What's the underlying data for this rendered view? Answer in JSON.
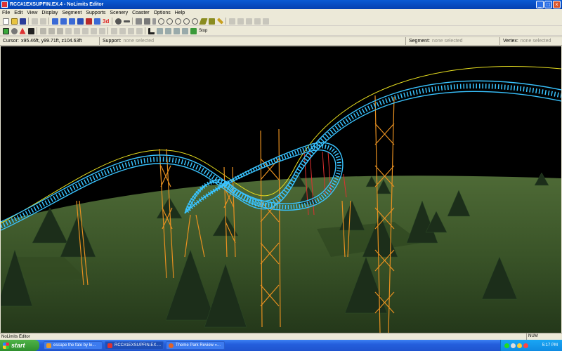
{
  "window": {
    "title": "RCC#1EXSUPFIN.EX.4 - NoLimits Editor"
  },
  "menu": [
    "File",
    "Edit",
    "View",
    "Display",
    "Segment",
    "Supports",
    "Scenery",
    "Coaster",
    "Options",
    "Help"
  ],
  "toolbar1_icons": [
    "new-file-icon",
    "open-file-icon",
    "save-icon",
    "undo-icon",
    "redo-icon",
    "track-up-icon",
    "track-wave-icon",
    "track-down-icon",
    "train-icon",
    "train-station-icon",
    "bolt-icon",
    "3d-view-icon",
    "add-vertex-icon",
    "remove-vertex-icon",
    "pencil-icon",
    "paint-icon",
    "dollar-icon",
    "support-a-icon",
    "support-b-icon",
    "support-c-icon",
    "support-d-icon",
    "support-e-icon",
    "measure-icon",
    "paint-bucket-icon",
    "highlight-icon",
    "tool-a-icon",
    "tool-b-icon",
    "tool-c-icon",
    "tool-d-icon",
    "tool-e-icon"
  ],
  "toolbar1_label_3d": "3d",
  "toolbar2_label_stop": "Stop",
  "infobar": {
    "cursor_label": "Cursor:",
    "cursor_value": "x95.46ft, y99.71ft, z104.63ft",
    "support_label": "Support:",
    "support_value": "none selected",
    "segment_label": "Segment:",
    "segment_value": "none selected",
    "vertex_label": "Vertex:",
    "vertex_value": "none selected"
  },
  "statusbar": {
    "text": "NoLimits Editor",
    "num": "NUM"
  },
  "taskbar": {
    "start_label": "start",
    "tasks": [
      {
        "label": "escape the fate by le...",
        "color": "#e89a2a"
      },
      {
        "label": "RCC#1EXSUPFIN.EX....",
        "color": "#d33",
        "active": true
      },
      {
        "label": "Theme Park Review »...",
        "color": "#e0632a"
      }
    ],
    "clock": "5:17 PM"
  },
  "colors": {
    "track": "#39c3ff",
    "heartline": "#e8e020",
    "support": "#e89020",
    "support_red": "#e03030",
    "terrain": "#3c5a2a",
    "sky": "#000000"
  }
}
